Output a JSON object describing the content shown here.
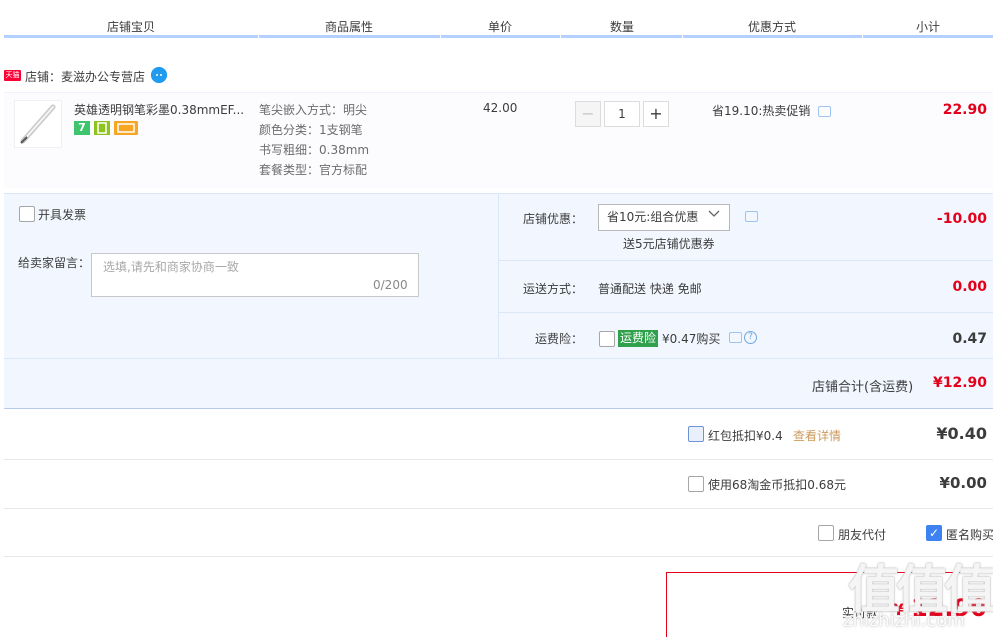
{
  "header": {
    "cols": [
      "店铺宝贝",
      "商品属性",
      "单价",
      "数量",
      "优惠方式",
      "小计"
    ]
  },
  "shop": {
    "badge": "天猫",
    "name": "店铺：麦滋办公专营店"
  },
  "item": {
    "title": "英雄透明钢笔彩墨0.38mmEF...",
    "badge7": "7",
    "attrs": [
      "笔尖嵌入方式：明尖",
      "颜色分类：1支钢笔",
      "书写粗细：0.38mm",
      "套餐类型：官方标配"
    ],
    "price": "42.00",
    "qty_minus": "−",
    "qty": "1",
    "qty_plus": "+",
    "promo": "省19.10:热卖促销",
    "subtotal": "22.90"
  },
  "order": {
    "invoice_label": "开具发票",
    "memo_label": "给卖家留言：",
    "memo_placeholder": "选填,请先和商家协商一致",
    "memo_count": "0/200",
    "shop_discount_label": "店铺优惠：",
    "shop_discount_value": "省10元:组合优惠",
    "shop_discount_note": "送5元店铺优惠券",
    "shop_discount_amount": "-10.00",
    "shipping_label": "运送方式：",
    "shipping_value": "普通配送 快递 免邮",
    "shipping_amount": "0.00",
    "insurance_label": "运费险：",
    "insurance_tag": "运费险",
    "insurance_text": "¥0.47购买",
    "insurance_amount": "0.47",
    "total_label": "店铺合计(含运费)",
    "total_amount": "¥12.90"
  },
  "extras": {
    "redpacket_label": "红包抵扣¥0.4",
    "redpacket_link": "查看详情",
    "redpacket_amount": "¥0.40",
    "coin_label": "使用68淘金币抵扣0.68元",
    "coin_amount": "¥0.00",
    "friend_pay": "朋友代付",
    "anonymous": "匿名购买",
    "check_mark": "✓"
  },
  "pay": {
    "label": "实付款：",
    "currency": "¥",
    "amount": "12.90"
  },
  "watermark": {
    "big": "值值值",
    "small": "zhizhizhi.com"
  }
}
